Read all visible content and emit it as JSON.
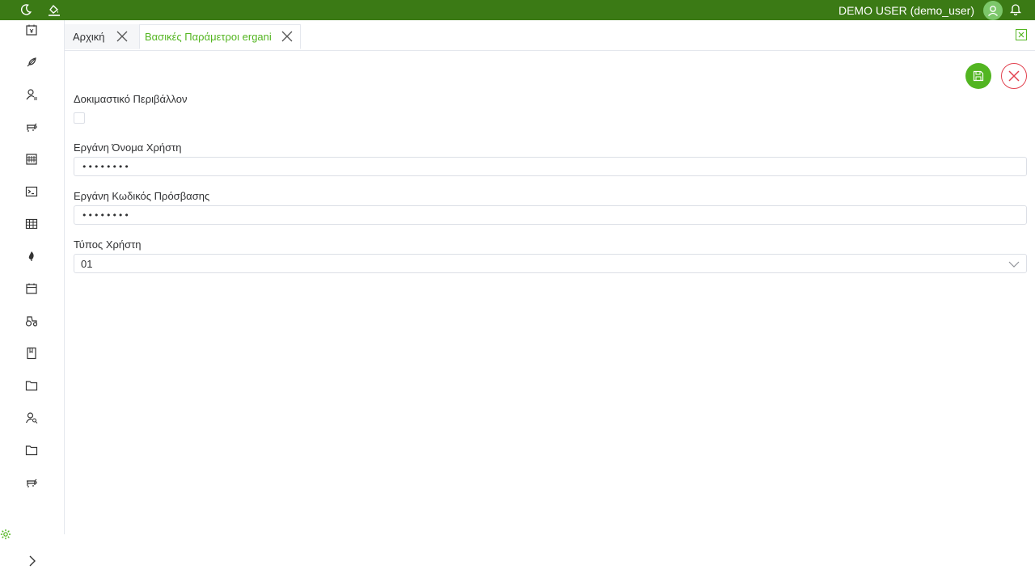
{
  "header": {
    "user_name": "DEMO USER (demo_user)",
    "theme_icon": "moon-icon",
    "style_icon": "paint-bucket-icon",
    "avatar_icon": "user-avatar-icon",
    "notification_icon": "bell-icon"
  },
  "colors": {
    "header_bg": "#3b7a15",
    "accent": "#54b521",
    "danger": "#e2414f"
  },
  "sidebar": {
    "items": [
      {
        "icon": "calendar-yen-icon"
      },
      {
        "icon": "feather-icon"
      },
      {
        "icon": "user-list-icon"
      },
      {
        "icon": "cow-icon"
      },
      {
        "icon": "building-icon"
      },
      {
        "icon": "terminal-icon"
      },
      {
        "icon": "table-grid-icon"
      },
      {
        "icon": "fire-icon"
      },
      {
        "icon": "calendar-icon"
      },
      {
        "icon": "tractor-icon"
      },
      {
        "icon": "book-icon"
      },
      {
        "icon": "folder-icon"
      },
      {
        "icon": "user-search-icon"
      },
      {
        "icon": "folder-icon"
      },
      {
        "icon": "cow-icon"
      }
    ],
    "settings_icon": "gear-icon",
    "expand_icon": "chevron-right-icon"
  },
  "tabs": [
    {
      "label": "Αρχική",
      "active": false
    },
    {
      "label": "Βασικές Παράμετροι ergani",
      "active": true
    }
  ],
  "actions": {
    "save_icon": "save-icon",
    "cancel_icon": "close-icon",
    "export_icon": "excel-icon"
  },
  "form": {
    "test_env": {
      "label": "Δοκιμαστικό Περιβάλλον",
      "checked": false
    },
    "username": {
      "label": "Εργάνη Όνομα Χρήστη",
      "value": "••••••••"
    },
    "password": {
      "label": "Εργάνη Κωδικός Πρόσβασης",
      "value": "••••••••"
    },
    "user_type": {
      "label": "Τύπος Χρήστη",
      "value": "01"
    }
  }
}
